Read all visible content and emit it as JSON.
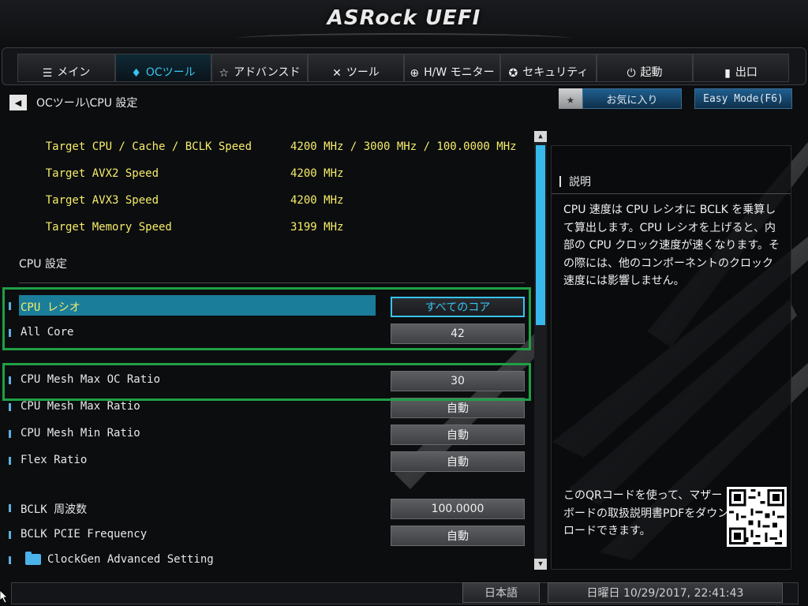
{
  "app": {
    "brand": "ASRock UEFI"
  },
  "tabs": [
    {
      "label": "メイン",
      "icon": "list-icon",
      "active": false
    },
    {
      "label": "OCツール",
      "icon": "flame-icon",
      "active": true
    },
    {
      "label": "アドバンスド",
      "icon": "star-icon",
      "active": false
    },
    {
      "label": "ツール",
      "icon": "tools-icon",
      "active": false
    },
    {
      "label": "H/W モニター",
      "icon": "monitor-icon",
      "active": false
    },
    {
      "label": "セキュリティ",
      "icon": "shield-icon",
      "active": false
    },
    {
      "label": "起動",
      "icon": "power-icon",
      "active": false
    },
    {
      "label": "出口",
      "icon": "exit-door-icon",
      "active": false
    }
  ],
  "breadcrumb": "OCツール\\CPU 設定",
  "favorites_label": "お気に入り",
  "easy_mode_label": "Easy Mode(F6)",
  "targets": [
    {
      "label": "Target CPU / Cache / BCLK Speed",
      "value": "4200 MHz / 3000 MHz / 100.0000 MHz"
    },
    {
      "label": "Target AVX2 Speed",
      "value": "4200 MHz"
    },
    {
      "label": "Target AVX3 Speed",
      "value": "4200 MHz"
    },
    {
      "label": "Target Memory Speed",
      "value": "3199 MHz"
    }
  ],
  "section_title": "CPU 設定",
  "settings": [
    {
      "label": "CPU レシオ",
      "value": "すべてのコア",
      "selected": true
    },
    {
      "label": "All Core",
      "value": "42"
    },
    {
      "label": "CPU Mesh Max OC Ratio",
      "value": "30"
    },
    {
      "label": "CPU Mesh Max Ratio",
      "value": "自動"
    },
    {
      "label": "CPU Mesh Min Ratio",
      "value": "自動"
    },
    {
      "label": "Flex Ratio",
      "value": "自動"
    },
    {
      "label": "BCLK 周波数",
      "value": "100.0000"
    },
    {
      "label": "BCLK PCIE Frequency",
      "value": "自動"
    },
    {
      "label": "ClockGen Advanced Setting",
      "value": ""
    }
  ],
  "description": {
    "title": "説明",
    "text": "CPU 速度は CPU レシオに BCLK を乗算して算出します。CPU レシオを上げると、内部の CPU クロック速度が速くなります。その際には、他のコンポーネントのクロック速度には影響しません。",
    "qr_text": "このQRコードを使って、マザーボードの取扱説明書PDFをダウンロードできます。"
  },
  "status": {
    "language": "日本語",
    "datetime": "日曜日 10/29/2017, 22:41:43"
  },
  "colors": {
    "accent": "#38c4f0",
    "target_yellow": "#f5ed6a",
    "highlight": "#1a7d9a",
    "annotation_green": "#1fa046"
  }
}
